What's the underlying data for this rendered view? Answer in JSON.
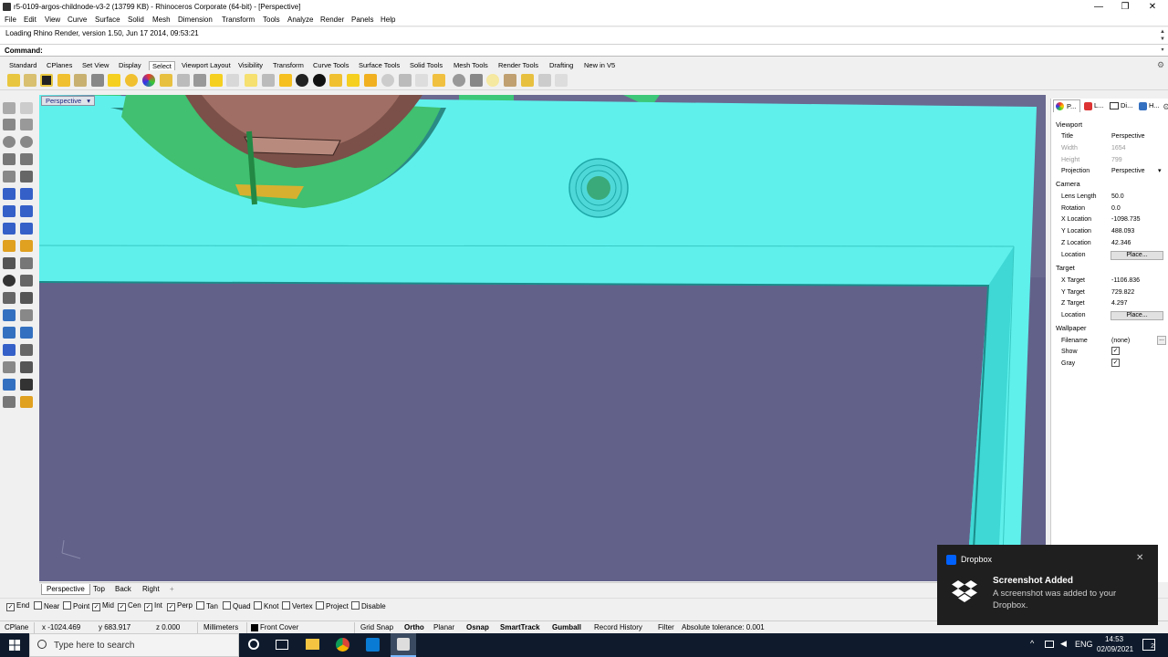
{
  "window": {
    "title": "r5-0109-argos-childnode-v3-2 (13799 KB) - Rhinoceros Corporate (64-bit) - [Perspective]",
    "minimize": "—",
    "restore": "❐",
    "close": "✕"
  },
  "menu": [
    "File",
    "Edit",
    "View",
    "Curve",
    "Surface",
    "Solid",
    "Mesh",
    "Dimension",
    "Transform",
    "Tools",
    "Analyze",
    "Render",
    "Panels",
    "Help"
  ],
  "command": {
    "history": "Loading Rhino Render, version 1.50, Jun 17 2014, 09:53:21",
    "prompt": "Command:"
  },
  "toolbar_tabs": [
    "Standard",
    "CPlanes",
    "Set View",
    "Display",
    "Select",
    "Viewport Layout",
    "Visibility",
    "Transform",
    "Curve Tools",
    "Surface Tools",
    "Solid Tools",
    "Mesh Tools",
    "Render Tools",
    "Drafting",
    "New in V5"
  ],
  "toolbar_active_tab": "Select",
  "viewport": {
    "label": "Perspective",
    "tabs": [
      "Perspective",
      "Top",
      "Back",
      "Right"
    ],
    "add_tab": "+"
  },
  "osnap": [
    {
      "label": "End",
      "checked": true
    },
    {
      "label": "Near",
      "checked": false
    },
    {
      "label": "Point",
      "checked": false
    },
    {
      "label": "Mid",
      "checked": true
    },
    {
      "label": "Cen",
      "checked": true
    },
    {
      "label": "Int",
      "checked": true
    },
    {
      "label": "Perp",
      "checked": true
    },
    {
      "label": "Tan",
      "checked": false
    },
    {
      "label": "Quad",
      "checked": false
    },
    {
      "label": "Knot",
      "checked": false
    },
    {
      "label": "Vertex",
      "checked": false
    },
    {
      "label": "Project",
      "checked": false
    },
    {
      "label": "Disable",
      "checked": false
    }
  ],
  "status": {
    "cplane": "CPlane",
    "x": "x -1024.469",
    "y": "y 683.917",
    "z": "z 0.000",
    "units": "Millimeters",
    "layer": "Front Cover",
    "grid_snap": "Grid Snap",
    "ortho": "Ortho",
    "planar": "Planar",
    "osnap": "Osnap",
    "smarttrack": "SmartTrack",
    "gumball": "Gumball",
    "record_history": "Record History",
    "filter": "Filter",
    "tolerance": "Absolute tolerance: 0.001"
  },
  "panel": {
    "tabs": [
      "P...",
      "L...",
      "Di...",
      "H..."
    ],
    "sections": {
      "viewport": "Viewport",
      "camera": "Camera",
      "target": "Target",
      "wallpaper": "Wallpaper"
    },
    "viewport_rows": [
      {
        "k": "Title",
        "v": "Perspective"
      },
      {
        "k": "Width",
        "v": "1654"
      },
      {
        "k": "Height",
        "v": "799"
      },
      {
        "k": "Projection",
        "v": "Perspective"
      }
    ],
    "camera_rows": [
      {
        "k": "Lens Length",
        "v": "50.0"
      },
      {
        "k": "Rotation",
        "v": "0.0"
      },
      {
        "k": "X Location",
        "v": "-1098.735"
      },
      {
        "k": "Y Location",
        "v": "488.093"
      },
      {
        "k": "Z Location",
        "v": "42.346"
      },
      {
        "k": "Location",
        "v": "Place..."
      }
    ],
    "target_rows": [
      {
        "k": "X Target",
        "v": "-1106.836"
      },
      {
        "k": "Y Target",
        "v": "729.822"
      },
      {
        "k": "Z Target",
        "v": "4.297"
      },
      {
        "k": "Location",
        "v": "Place..."
      }
    ],
    "wallpaper_rows": [
      {
        "k": "Filename",
        "v": "(none)"
      },
      {
        "k": "Show",
        "v": "✓"
      },
      {
        "k": "Gray",
        "v": "✓"
      }
    ],
    "browse": "..."
  },
  "toast": {
    "app": "Dropbox",
    "heading": "Screenshot Added",
    "body": "A screenshot was added to your Dropbox.",
    "close": "✕"
  },
  "taskbar": {
    "search_placeholder": "Type here to search",
    "lang": "ENG",
    "time": "14:53",
    "date": "02/09/2021",
    "notifications": "2"
  },
  "colors": {
    "selection_cyan": "#5ff0ec",
    "viewport_bg": "#6a6990",
    "taskbar": "#0f1b2d"
  }
}
